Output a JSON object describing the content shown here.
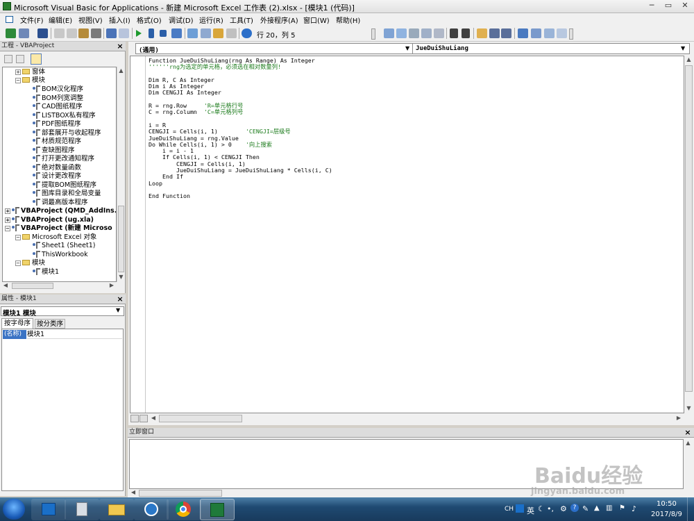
{
  "title": {
    "text": "Microsoft Visual Basic for Applications - 新建 Microsoft Excel 工作表 (2).xlsx - [模块1 (代码)]"
  },
  "menu": [
    "文件(F)",
    "编辑(E)",
    "视图(V)",
    "插入(I)",
    "格式(O)",
    "调试(D)",
    "运行(R)",
    "工具(T)",
    "外接程序(A)",
    "窗口(W)",
    "帮助(H)"
  ],
  "toolbar": {
    "position": "行 20，列 5"
  },
  "project": {
    "title": "工程 - VBAProject",
    "rows": [
      "窗体",
      "模块",
      "BOM汉化程序",
      "BOM列宽调整",
      "CAD图纸程序",
      "LISTBOX私有程序",
      "PDF图纸程序",
      "部套展开与收起程序",
      "材质规范程序",
      "查缺图程序",
      "打开更改通知程序",
      "绝对数量函数",
      "设计更改程序",
      "提取BOM图纸程序",
      "图库目录和全局变量",
      "调最高版本程序",
      "VBAProject (QMD_AddIns.x",
      "VBAProject (ug.xla)",
      "VBAProject (新建 Microso",
      "Microsoft Excel 对象",
      "Sheet1 (Sheet1)",
      "ThisWorkbook",
      "模块",
      "模块1"
    ]
  },
  "props": {
    "title": "属性 - 模块1",
    "object": "模块1 模块",
    "tabs": [
      "按字母序",
      "按分类序"
    ],
    "row_name": "(名称)",
    "row_value": "模块1"
  },
  "code": {
    "combo_left": "(通用)",
    "combo_right": "JueDuiShuLiang",
    "lines": [
      [
        "Function JueDuiShuLiang(rng As Range) As Integer",
        ""
      ],
      [
        "",
        "''''''rng为选定的单元格，必须选在相对数量列!"
      ],
      [
        "",
        ""
      ],
      [
        "Dim R, C As Integer",
        ""
      ],
      [
        "Dim i As Integer",
        ""
      ],
      [
        "Dim CENGJI As Integer",
        ""
      ],
      [
        "",
        ""
      ],
      [
        "R = rng.Row     ",
        "'R=单元格行号"
      ],
      [
        "C = rng.Column  ",
        "'C=单元格列号"
      ],
      [
        "",
        ""
      ],
      [
        "i = R",
        ""
      ],
      [
        "CENGJI = Cells(i, 1)        ",
        "'CENGJI=层级号"
      ],
      [
        "JueDuiShuLiang = rng.Value",
        ""
      ],
      [
        "Do While Cells(i, 1) > 0    ",
        "'向上搜索"
      ],
      [
        "    i = i - 1",
        ""
      ],
      [
        "    If Cells(i, 1) < CENGJI Then",
        ""
      ],
      [
        "        CENGJI = Cells(i, 1)",
        ""
      ],
      [
        "        JueDuiShuLiang = JueDuiShuLiang * Cells(i, C)",
        ""
      ],
      [
        "    End If",
        ""
      ],
      [
        "Loop",
        ""
      ],
      [
        "",
        ""
      ],
      [
        "End Function",
        ""
      ]
    ]
  },
  "immediate": {
    "title": "立即窗口"
  },
  "taskbar": {
    "lang": "CH",
    "ime": "英",
    "time": "10:50",
    "date": "2017/8/9"
  },
  "watermark": {
    "logo": "Baidu经验",
    "url": "jingyan.baidu.com"
  }
}
